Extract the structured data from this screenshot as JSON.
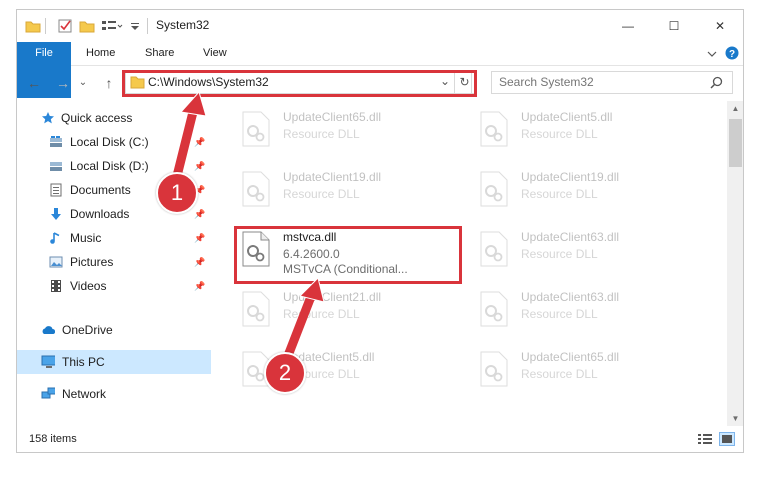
{
  "window": {
    "title": "System32",
    "controls": {
      "minimize": "—",
      "maximize": "☐",
      "close": "✕"
    }
  },
  "ribbon": {
    "tabs": [
      "File",
      "Home",
      "Share",
      "View"
    ],
    "expand_icon": "chevron-down-icon",
    "help_icon": "help-icon"
  },
  "navigation": {
    "back": "←",
    "forward": "→",
    "recent": "⌄",
    "up": "↑",
    "address": "C:\\Windows\\System32",
    "address_dropdown": "⌄",
    "refresh": "↻",
    "search_placeholder": "Search System32"
  },
  "sidebar": {
    "items": [
      {
        "label": "Quick access",
        "icon": "star-icon",
        "pinned": false
      },
      {
        "label": "Local Disk (C:)",
        "icon": "drive-icon",
        "pinned": true
      },
      {
        "label": "Local Disk (D:)",
        "icon": "drive-icon",
        "pinned": true
      },
      {
        "label": "Documents",
        "icon": "documents-icon",
        "pinned": true
      },
      {
        "label": "Downloads",
        "icon": "downloads-icon",
        "pinned": true
      },
      {
        "label": "Music",
        "icon": "music-icon",
        "pinned": true
      },
      {
        "label": "Pictures",
        "icon": "pictures-icon",
        "pinned": true
      },
      {
        "label": "Videos",
        "icon": "videos-icon",
        "pinned": true
      },
      {
        "label": "OneDrive",
        "icon": "onedrive-icon",
        "pinned": false
      },
      {
        "label": "This PC",
        "icon": "this-pc-icon",
        "pinned": false,
        "selected": true
      },
      {
        "label": "Network",
        "icon": "network-icon",
        "pinned": false
      }
    ]
  },
  "files": {
    "left_column": [
      {
        "name": "UpdateClient65.dll",
        "line2": "Resource DLL",
        "line3": "",
        "faded": true
      },
      {
        "name": "UpdateClient19.dll",
        "line2": "Resource DLL",
        "line3": "",
        "faded": true
      },
      {
        "name": "mstvca.dll",
        "line2": "6.4.2600.0",
        "line3": "MSTvCA (Conditional...",
        "faded": false
      },
      {
        "name": "UpdateClient21.dll",
        "line2": "Resource DLL",
        "line3": "",
        "faded": true
      },
      {
        "name": "UpdateClient5.dll",
        "line2": "Resource DLL",
        "line3": "",
        "faded": true
      }
    ],
    "right_column": [
      {
        "name": "UpdateClient5.dll",
        "line2": "Resource DLL",
        "faded": true
      },
      {
        "name": "UpdateClient19.dll",
        "line2": "Resource DLL",
        "faded": true
      },
      {
        "name": "UpdateClient63.dll",
        "line2": "Resource DLL",
        "faded": true
      },
      {
        "name": "UpdateClient63.dll",
        "line2": "Resource DLL",
        "faded": true
      },
      {
        "name": "UpdateClient65.dll",
        "line2": "Resource DLL",
        "faded": true
      }
    ]
  },
  "status": {
    "item_count": "158 items",
    "details_view_icon": "details-view-icon",
    "large_icons_view_icon": "large-icons-view-icon"
  },
  "annotations": {
    "step1": "1",
    "step2": "2",
    "highlight_color": "#d9343b"
  },
  "colors": {
    "accent": "#1979ca",
    "selection": "#cce8ff",
    "highlight": "#d9343b"
  }
}
